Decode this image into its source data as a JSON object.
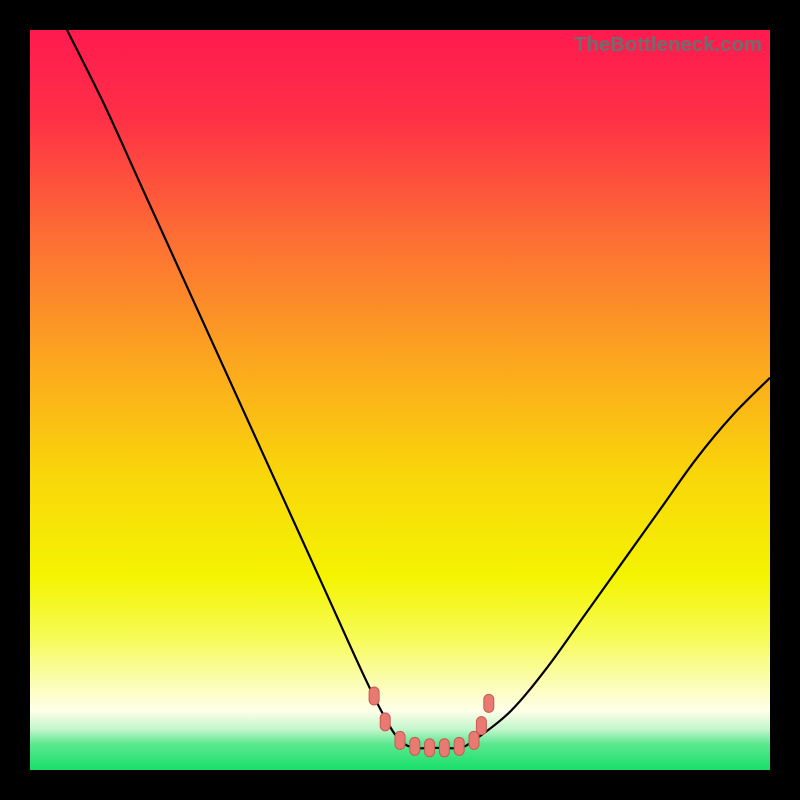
{
  "watermark": "TheBottleneck.com",
  "colors": {
    "frame": "#000000",
    "curve": "#000000",
    "marker_fill": "#e87a72",
    "marker_stroke": "#c85a54",
    "gradient_stops": [
      {
        "offset": 0.0,
        "color": "#fe1a4f"
      },
      {
        "offset": 0.12,
        "color": "#fe3046"
      },
      {
        "offset": 0.28,
        "color": "#fd6e34"
      },
      {
        "offset": 0.44,
        "color": "#fca420"
      },
      {
        "offset": 0.6,
        "color": "#f9d60a"
      },
      {
        "offset": 0.74,
        "color": "#f4f402"
      },
      {
        "offset": 0.82,
        "color": "#f7fb55"
      },
      {
        "offset": 0.88,
        "color": "#fbfdb0"
      },
      {
        "offset": 0.92,
        "color": "#feffe8"
      },
      {
        "offset": 0.945,
        "color": "#c3f6cc"
      },
      {
        "offset": 0.965,
        "color": "#5be88f"
      },
      {
        "offset": 1.0,
        "color": "#18df6a"
      }
    ]
  },
  "chart_data": {
    "type": "line",
    "title": "",
    "xlabel": "",
    "ylabel": "",
    "xlim": [
      0,
      100
    ],
    "ylim": [
      0,
      100
    ],
    "grid": false,
    "series": [
      {
        "name": "bottleneck-curve",
        "x": [
          5,
          10,
          15,
          20,
          25,
          30,
          35,
          40,
          45,
          48,
          50,
          52,
          55,
          58,
          60,
          65,
          70,
          75,
          80,
          85,
          90,
          95,
          100
        ],
        "y": [
          100,
          90,
          79,
          68,
          57,
          46,
          35,
          24,
          13,
          7,
          4,
          3,
          3,
          3,
          4,
          8,
          14,
          21,
          28,
          35,
          42,
          48,
          53
        ]
      }
    ],
    "markers": {
      "name": "highlight-points",
      "x": [
        46.5,
        48.0,
        50.0,
        52.0,
        54.0,
        56.0,
        58.0,
        60.0,
        61.0,
        62.0
      ],
      "y": [
        10.0,
        6.5,
        4.0,
        3.2,
        3.0,
        3.0,
        3.2,
        4.0,
        6.0,
        9.0
      ]
    }
  }
}
